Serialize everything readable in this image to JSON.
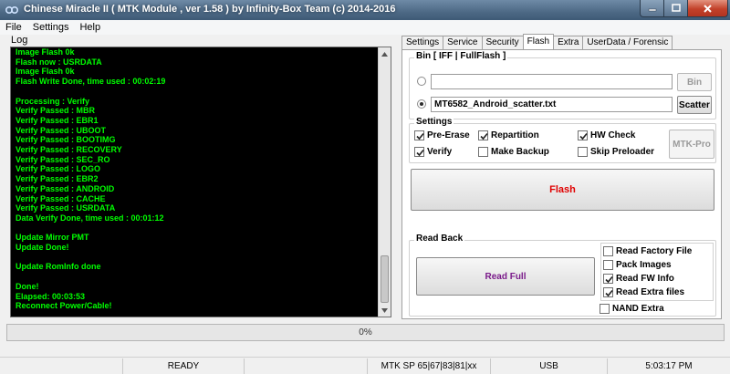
{
  "window": {
    "title": "Chinese Miracle II ( MTK Module , ver 1.58 ) by Infinity-Box Team (c) 2014-2016",
    "icon": "app-icon"
  },
  "menu": [
    "File",
    "Settings",
    "Help"
  ],
  "log": {
    "label": "Log",
    "text": "Image Flash 0k\nFlash now : USRDATA\nImage Flash 0k\nFlash Write Done, time used : 00:02:19\n\nProcessing : Verify\nVerify Passed : MBR\nVerify Passed : EBR1\nVerify Passed : UBOOT\nVerify Passed : BOOTIMG\nVerify Passed : RECOVERY\nVerify Passed : SEC_RO\nVerify Passed : LOGO\nVerify Passed : EBR2\nVerify Passed : ANDROID\nVerify Passed : CACHE\nVerify Passed : USRDATA\nData Verify Done, time used : 00:01:12\n\nUpdate Mirror PMT\nUpdate Done!\n\nUpdate RomInfo done\n\nDone!\nElapsed: 00:03:53\nReconnect Power/Cable!"
  },
  "tabs": [
    "Settings",
    "Service",
    "Security",
    "Flash",
    "Extra",
    "UserData / Forensic"
  ],
  "active_tab": "Flash",
  "bin": {
    "title": "Bin  [ IFF | FullFlash ]",
    "bin_value": "",
    "bin_button": "Bin",
    "scatter_value": "MT6582_Android_scatter.txt",
    "scatter_button": "Scatter",
    "selected": "scatter"
  },
  "settings": {
    "title": "Settings",
    "pre_erase": {
      "label": "Pre-Erase",
      "checked": true
    },
    "repartition": {
      "label": "Repartition",
      "checked": true
    },
    "hw_check": {
      "label": "HW Check",
      "checked": true
    },
    "verify": {
      "label": "Verify",
      "checked": true
    },
    "make_backup": {
      "label": "Make Backup",
      "checked": false
    },
    "skip_preloader": {
      "label": "Skip Preloader",
      "checked": false
    },
    "mtk_pro_button": "MTK-Pro"
  },
  "flash_button": {
    "label": "Flash",
    "color": "#e00000"
  },
  "read_back": {
    "title": "Read Back",
    "read_full_button": {
      "label": "Read Full",
      "color": "#7a1a8a"
    },
    "read_factory_file": {
      "label": "Read Factory File",
      "checked": false
    },
    "pack_images": {
      "label": "Pack Images",
      "checked": false
    },
    "read_fw_info": {
      "label": "Read FW Info",
      "checked": true
    },
    "read_extra_files": {
      "label": "Read Extra files",
      "checked": true
    }
  },
  "nand_extra": {
    "label": "NAND Extra",
    "checked": false
  },
  "progress": {
    "text": "0%",
    "value": 0,
    "color": "#06b025"
  },
  "status": {
    "state": "READY",
    "platform": "MTK SP 65|67|83|81|xx",
    "connection": "USB",
    "time": "5:03:17 PM"
  }
}
